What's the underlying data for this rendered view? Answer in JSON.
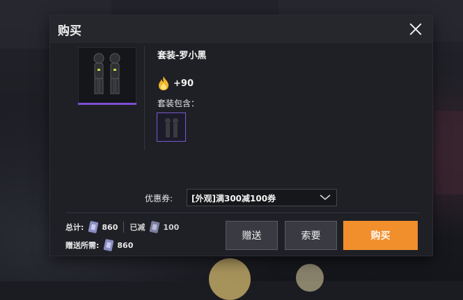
{
  "dialog": {
    "title": "购买",
    "item_name": "套装-罗小黑",
    "heat_value": "+90",
    "includes_label": "套装包含："
  },
  "coupon": {
    "label": "优惠券:",
    "selected": "[外观]满300减100券"
  },
  "footer": {
    "total_label": "总计:",
    "total_value": "860",
    "discount_label": "已减",
    "discount_value": "100",
    "gift_label": "赠送所需:",
    "gift_value": "860"
  },
  "buttons": {
    "gift": "赠送",
    "request": "索要",
    "buy": "购买"
  },
  "colors": {
    "accent": "#f08f2c",
    "rarity": "#7b4fd6"
  },
  "icons": [
    "close-icon",
    "flame-icon",
    "chevron-down-icon",
    "ticket-icon"
  ]
}
